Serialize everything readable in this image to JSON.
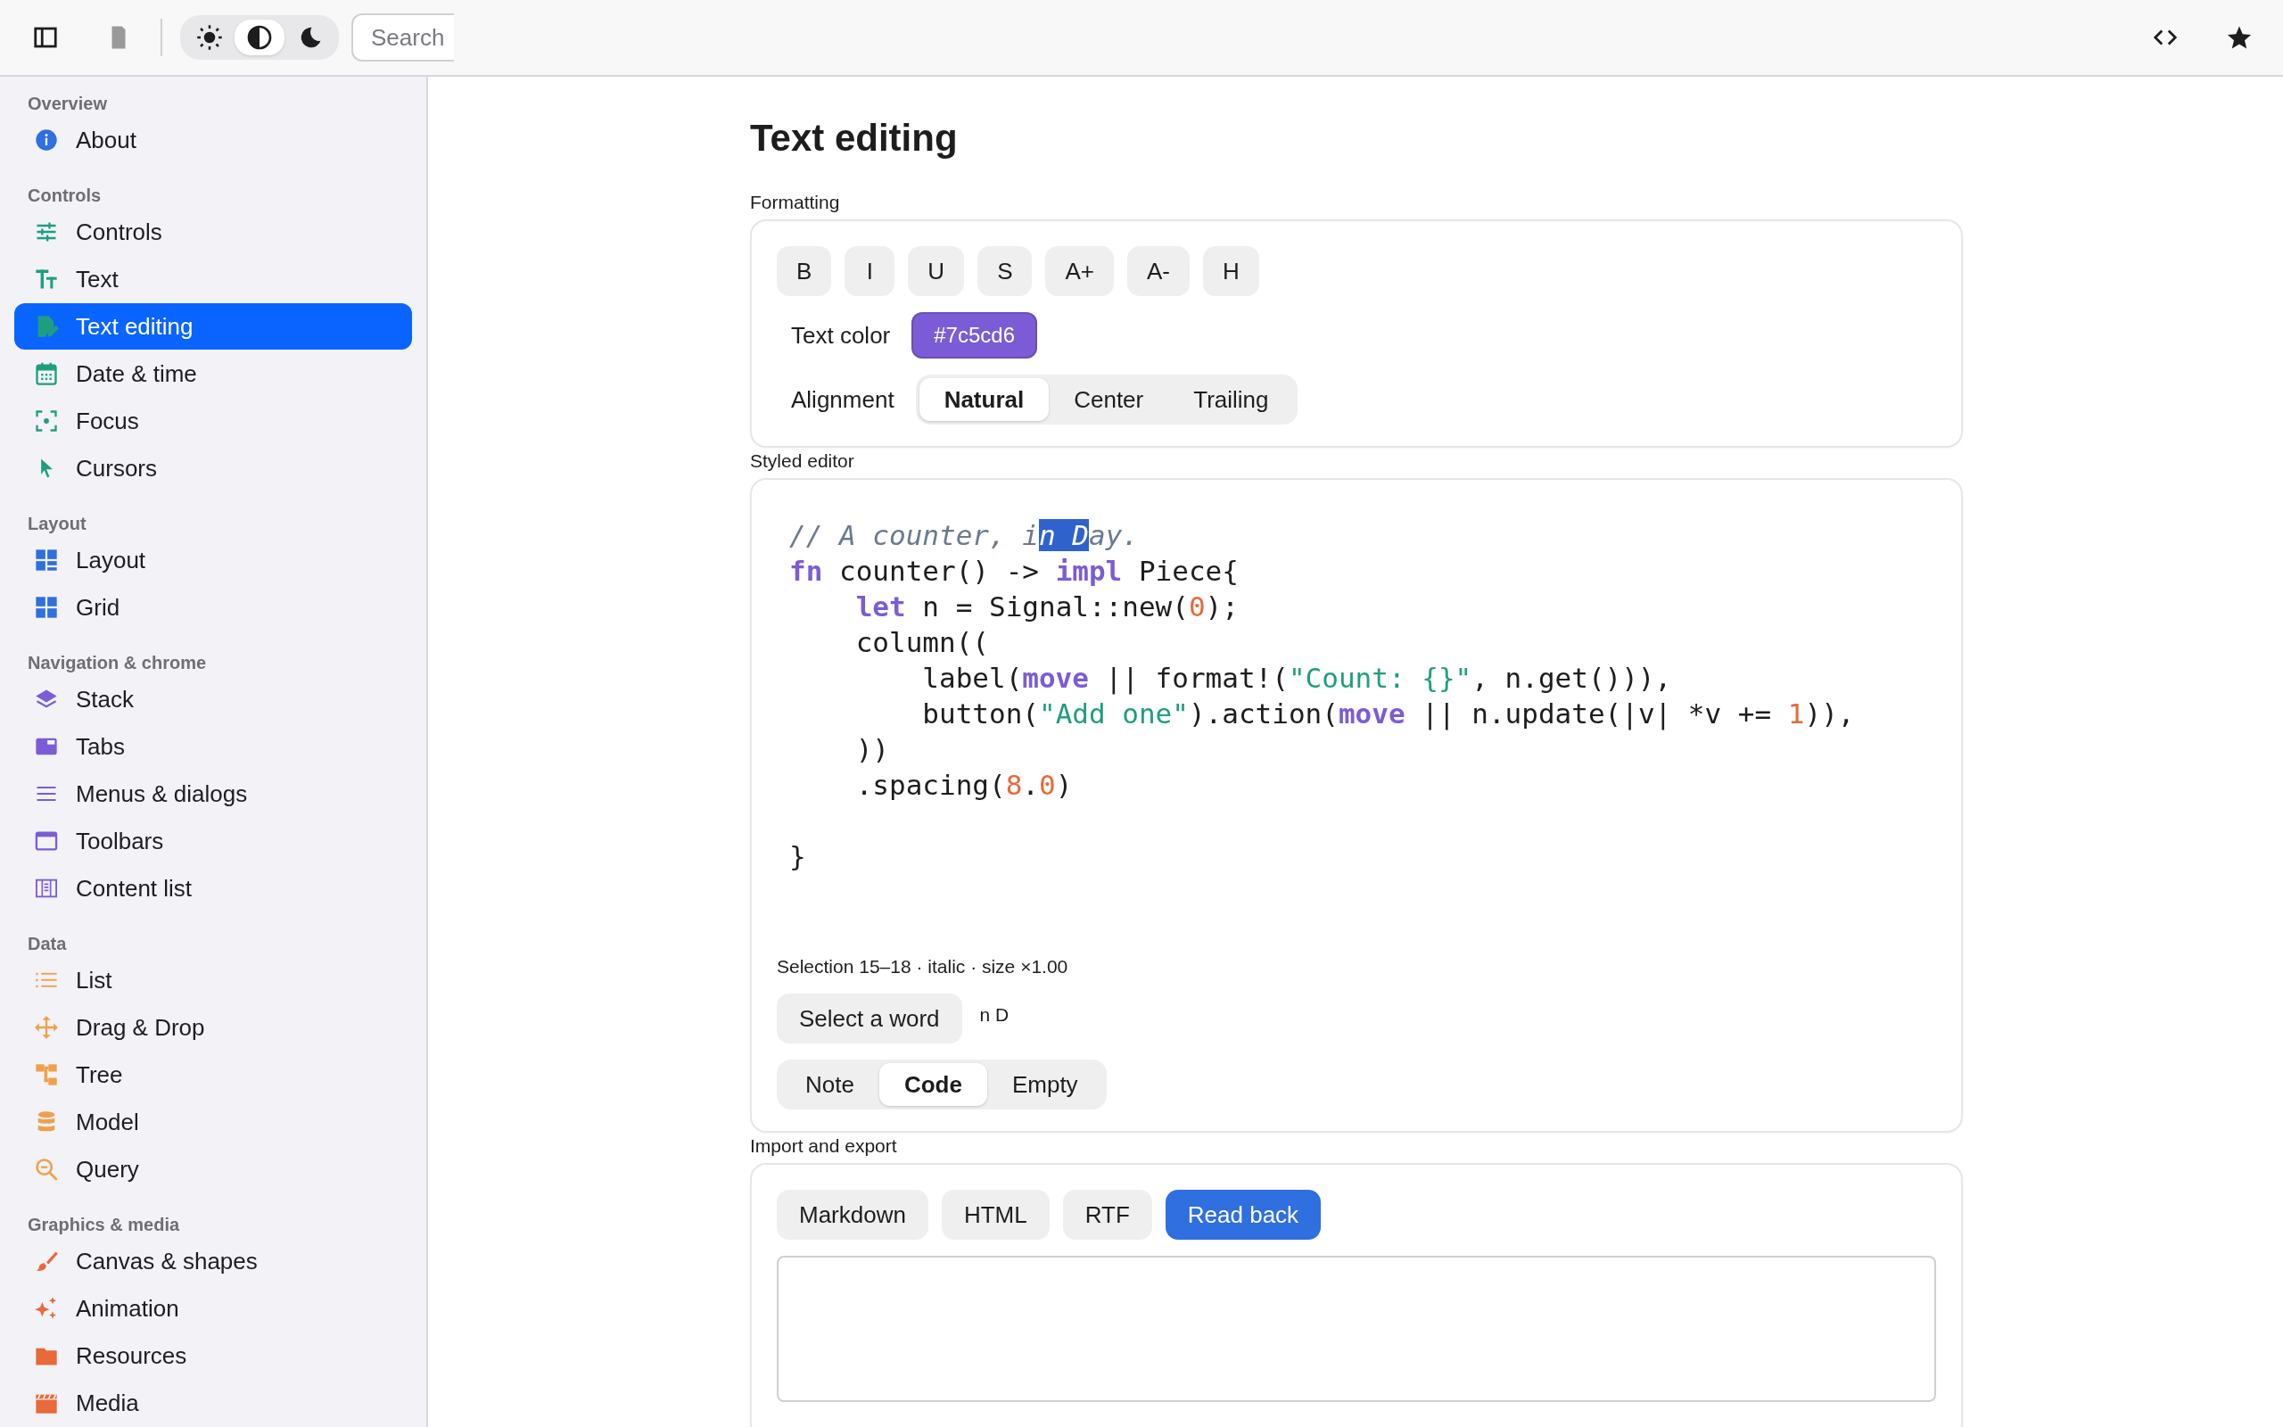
{
  "toolbar": {
    "theme_options": [
      {
        "selected": false
      },
      {
        "selected": true
      },
      {
        "selected": false
      }
    ],
    "search": {
      "placeholder": "Search"
    }
  },
  "sidebar": {
    "sections": [
      {
        "title": "Overview",
        "items": [
          {
            "label": "About",
            "selected": false
          }
        ]
      },
      {
        "title": "Controls",
        "items": [
          {
            "label": "Controls",
            "selected": false
          },
          {
            "label": "Text",
            "selected": false
          },
          {
            "label": "Text editing",
            "selected": true
          },
          {
            "label": "Date & time",
            "selected": false
          },
          {
            "label": "Focus",
            "selected": false
          },
          {
            "label": "Cursors",
            "selected": false
          }
        ]
      },
      {
        "title": "Layout",
        "items": [
          {
            "label": "Layout",
            "selected": false
          },
          {
            "label": "Grid",
            "selected": false
          }
        ]
      },
      {
        "title": "Navigation & chrome",
        "items": [
          {
            "label": "Stack",
            "selected": false
          },
          {
            "label": "Tabs",
            "selected": false
          },
          {
            "label": "Menus & dialogs",
            "selected": false
          },
          {
            "label": "Toolbars",
            "selected": false
          },
          {
            "label": "Content list",
            "selected": false
          }
        ]
      },
      {
        "title": "Data",
        "items": [
          {
            "label": "List",
            "selected": false
          },
          {
            "label": "Drag & Drop",
            "selected": false
          },
          {
            "label": "Tree",
            "selected": false
          },
          {
            "label": "Model",
            "selected": false
          },
          {
            "label": "Query",
            "selected": false
          }
        ]
      },
      {
        "title": "Graphics & media",
        "items": [
          {
            "label": "Canvas & shapes",
            "selected": false
          },
          {
            "label": "Animation",
            "selected": false
          },
          {
            "label": "Resources",
            "selected": false
          },
          {
            "label": "Media",
            "selected": false
          }
        ]
      }
    ]
  },
  "page": {
    "title": "Text editing",
    "formatting": {
      "label": "Formatting",
      "buttons": [
        "B",
        "I",
        "U",
        "S",
        "A+",
        "A-",
        "H"
      ],
      "text_color": {
        "label": "Text color",
        "value": "#7c5cd6",
        "color": "#7c5cd6"
      },
      "alignment": {
        "label": "Alignment",
        "options": [
          {
            "label": "Natural",
            "selected": true
          },
          {
            "label": "Center",
            "selected": false
          },
          {
            "label": "Trailing",
            "selected": false
          }
        ]
      }
    },
    "styled_editor": {
      "label": "Styled editor",
      "lines": [
        {
          "kind": "code",
          "tokens": [
            {
              "text": "// A counter, i",
              "kind": "comment"
            },
            {
              "text": "n D",
              "kind": "selection"
            },
            {
              "text": "ay.",
              "kind": "comment"
            }
          ]
        },
        {
          "kind": "code",
          "tokens": [
            {
              "text": "fn",
              "kind": "keyword"
            },
            {
              "text": " counter() -> ",
              "kind": "plain"
            },
            {
              "text": "impl",
              "kind": "keyword"
            },
            {
              "text": " Piece{",
              "kind": "plain"
            }
          ]
        },
        {
          "kind": "code",
          "tokens": [
            {
              "text": "    let",
              "kind": "keyword"
            },
            {
              "text": " n = Signal::new(",
              "kind": "plain"
            },
            {
              "text": "0",
              "kind": "number"
            },
            {
              "text": ");",
              "kind": "plain"
            }
          ]
        },
        {
          "kind": "code",
          "tokens": [
            {
              "text": "    column((",
              "kind": "plain"
            }
          ]
        },
        {
          "kind": "code",
          "tokens": [
            {
              "text": "        label(",
              "kind": "plain"
            },
            {
              "text": "move",
              "kind": "keyword"
            },
            {
              "text": " || format!(",
              "kind": "plain"
            },
            {
              "text": "\"Count: {}\"",
              "kind": "string"
            },
            {
              "text": ", n.get())),",
              "kind": "plain"
            }
          ]
        },
        {
          "kind": "code",
          "tokens": [
            {
              "text": "        button(",
              "kind": "plain"
            },
            {
              "text": "\"Add one\"",
              "kind": "string"
            },
            {
              "text": ").action(",
              "kind": "plain"
            },
            {
              "text": "move",
              "kind": "keyword"
            },
            {
              "text": " || n.update(|v| *v += ",
              "kind": "plain"
            },
            {
              "text": "1",
              "kind": "number"
            },
            {
              "text": ")),",
              "kind": "plain"
            }
          ]
        },
        {
          "kind": "code",
          "tokens": [
            {
              "text": "    ))",
              "kind": "plain"
            }
          ]
        },
        {
          "kind": "code",
          "tokens": [
            {
              "text": "    .spacing(",
              "kind": "plain"
            },
            {
              "text": "8",
              "kind": "number"
            },
            {
              "text": ".",
              "kind": "plain"
            },
            {
              "text": "0",
              "kind": "number"
            },
            {
              "text": ")",
              "kind": "plain"
            }
          ]
        },
        {
          "kind": "blank"
        },
        {
          "kind": "code",
          "tokens": [
            {
              "text": "}",
              "kind": "plain"
            }
          ]
        }
      ],
      "selection_info": "Selection 15–18 · italic · size ×1.00",
      "select_button": "Select a word",
      "selected_text": "n D",
      "modes": [
        {
          "label": "Note",
          "selected": false
        },
        {
          "label": "Code",
          "selected": true
        },
        {
          "label": "Empty",
          "selected": false
        }
      ]
    },
    "import_export": {
      "label": "Import and export",
      "buttons": [
        {
          "label": "Markdown",
          "kind": "plain"
        },
        {
          "label": "HTML",
          "kind": "plain"
        },
        {
          "label": "RTF",
          "kind": "plain"
        },
        {
          "label": "Read back",
          "kind": "primary"
        }
      ]
    }
  }
}
